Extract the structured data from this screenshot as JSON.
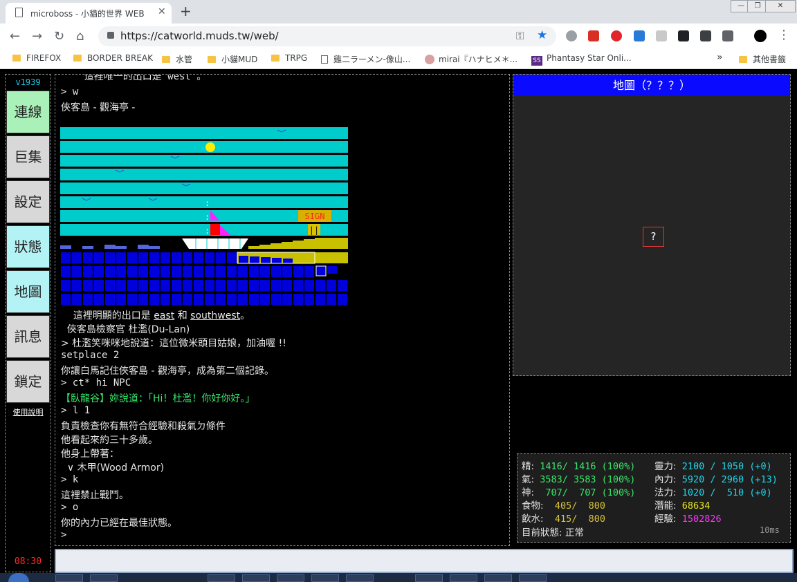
{
  "browser": {
    "tab_title": "microboss - 小貓的世界 WEB",
    "tab_close": "✕",
    "new_tab": "+",
    "url": "https://catworld.muds.tw/web/",
    "win_min": "—",
    "win_max": "❐",
    "win_close": "✕",
    "nav_back": "←",
    "nav_forward": "→",
    "nav_reload": "↻",
    "nav_home": "⌂",
    "key_icon": "⚿",
    "star_icon": "★",
    "profile_menu": "⋮",
    "bookmarks": [
      {
        "label": "FIREFOX",
        "icon": "folder"
      },
      {
        "label": "BORDER BREAK",
        "icon": "folder"
      },
      {
        "label": "水管",
        "icon": "folder"
      },
      {
        "label": "小貓MUD",
        "icon": "folder"
      },
      {
        "label": "TRPG",
        "icon": "folder"
      },
      {
        "label": "雞二ラーメン-像山...",
        "icon": "page"
      },
      {
        "label": "mirai『ハナヒメ＊...",
        "icon": "avatar"
      },
      {
        "label": "Phantasy Star Onli...",
        "icon": "ss"
      }
    ],
    "bookmarks_more": "»",
    "other_bookmarks": "其他書籤",
    "ss_badge": "SS"
  },
  "sidebar": {
    "version": "v1939",
    "buttons": [
      "連線",
      "巨集",
      "設定",
      "狀態",
      "地圖",
      "訊息",
      "鎖定"
    ],
    "help": "使用說明",
    "clock": "08:30"
  },
  "terminal": {
    "line_top": "    這裡唯一的出口是 west 。",
    "cmd_w": "> w",
    "room_title": "俠客島 - 觀海亭 -",
    "exits_prefix": "    這裡明顯的出口是 ",
    "exit_east": "east",
    "exits_and": " 和 ",
    "exit_sw": "southwest",
    "exits_suffix": "。",
    "npc": "  俠客島檢察官 杜濫(Du-Lan)",
    "npc_say": "> 杜濫笑咪咪地說道：這位微米頭目姑娘，加油喔 !!",
    "setplace": "setplace 2",
    "record": "你讓白馬記住俠客島 - 觀海亭，成為第二個記錄。",
    "ct_cmd": "> ct* hi NPC",
    "channel": "【臥龍谷】妳說道：「Hi！杜濫！你好你好。」",
    "l1": "> l 1",
    "desc1": "負責檢查你有無符合經驗和殺氣ㄉ條件",
    "desc2": "他看起來約三十多歲。",
    "desc3": "他身上帶著：",
    "equip": "  ∨ 木甲(Wood Armor)",
    "k": "> k",
    "nofight": "這裡禁止戰鬥。",
    "o": "> o",
    "inner": "你的內力已經在最佳狀態。",
    "prompt": ">",
    "sign": "SIGN",
    "sign_post": "||",
    "mast": ":"
  },
  "map": {
    "title": "地圖（？？？）",
    "cell": "?"
  },
  "stats": {
    "rows": [
      {
        "l1": "精:",
        "v1": " 1416/ 1416 (100%)",
        "l2": "靈力:",
        "v2": " 2100 / 1050 (+0)"
      },
      {
        "l1": "氣:",
        "v1": " 3583/ 3583 (100%)",
        "l2": "內力:",
        "v2": " 5920 / 2960 (+13)"
      },
      {
        "l1": "神:",
        "v1": "  707/  707 (100%)",
        "l2": "法力:",
        "v2": " 1020 /  510 (+0)"
      },
      {
        "l1": "食物:",
        "v1": "  405/  800",
        "l2": "潛能:",
        "v2": " 68634"
      },
      {
        "l1": "飲水:",
        "v1": "  415/  800",
        "l2": "經驗:",
        "v2": " 1502826"
      }
    ],
    "status_label": "目前狀態:",
    "status_value": " 正常",
    "latency": "10ms"
  }
}
